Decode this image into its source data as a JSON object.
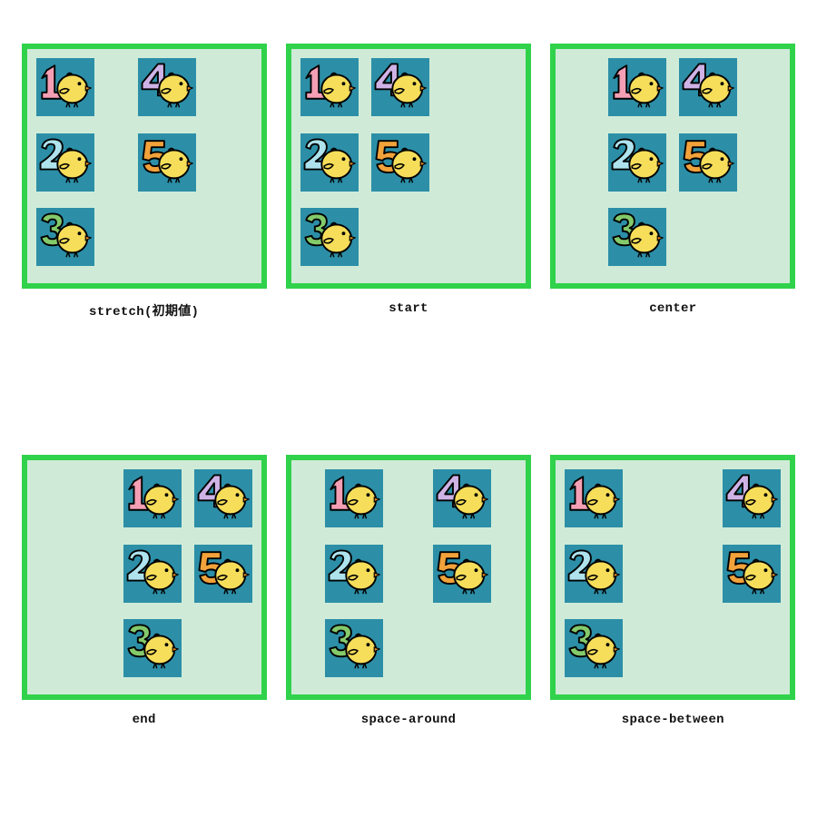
{
  "tile_values": [
    1,
    2,
    3,
    4,
    5
  ],
  "palette": {
    "border": "#30d24b",
    "panel_bg": "#cfebd8",
    "tile_bg": "#2c8fa7",
    "chick": "#f6de5a",
    "beak": "#e58a1f",
    "num_colors": {
      "1": "#f59fb5",
      "2": "#aee3ee",
      "3": "#84c96a",
      "4": "#cfb3e6",
      "5": "#f2a23a"
    }
  },
  "examples": [
    {
      "id": "stretch",
      "caption": "stretch(初期値)",
      "col_class": "col-stretch"
    },
    {
      "id": "start",
      "caption": "start",
      "col_class": "col-start"
    },
    {
      "id": "center",
      "caption": "center",
      "col_class": "col-center"
    },
    {
      "id": "end",
      "caption": "end",
      "col_class": "col-end"
    },
    {
      "id": "space-around",
      "caption": "space-around",
      "col_class": "col-around"
    },
    {
      "id": "space-between",
      "caption": "space-between",
      "col_class": "col-between"
    }
  ]
}
